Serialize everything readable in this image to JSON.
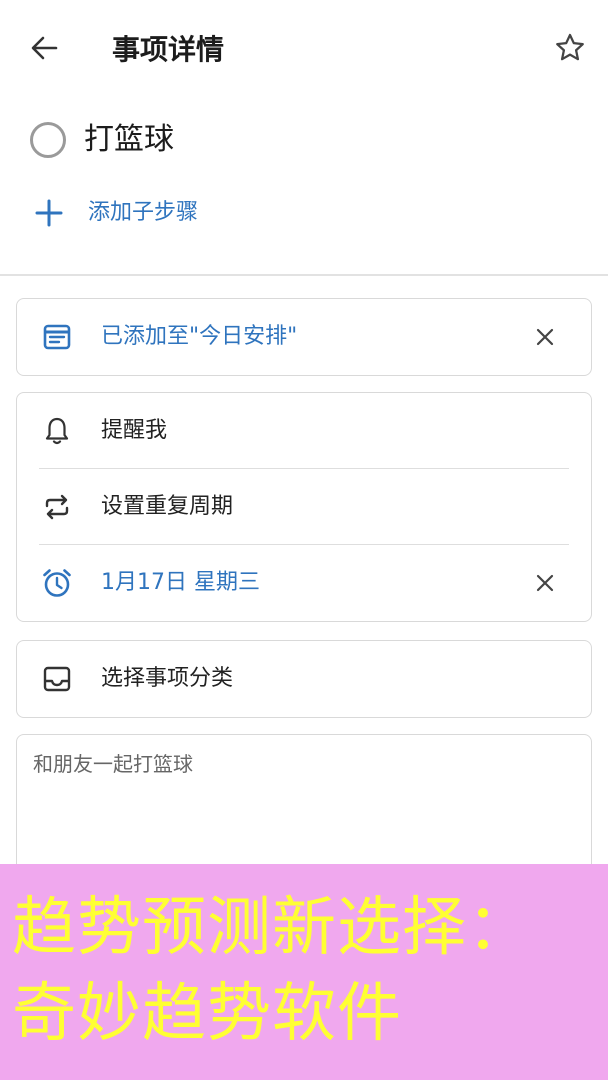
{
  "header": {
    "title": "事项详情"
  },
  "task": {
    "title": "打篮球"
  },
  "add_step": {
    "label": "添加子步骤"
  },
  "my_day_card": {
    "label": "已添加至\"今日安排\""
  },
  "schedule_card": {
    "remind_label": "提醒我",
    "repeat_label": "设置重复周期",
    "due_label": "1月17日 星期三"
  },
  "category_card": {
    "label": "选择事项分类"
  },
  "note": {
    "text": "和朋友一起打篮球"
  },
  "banner": {
    "line1": "趋势预测新选择：",
    "line2": "奇妙趋势软件"
  },
  "colors": {
    "accent": "#2f74be",
    "banner_bg": "#f0a8ee",
    "banner_text": "#ffff33"
  }
}
